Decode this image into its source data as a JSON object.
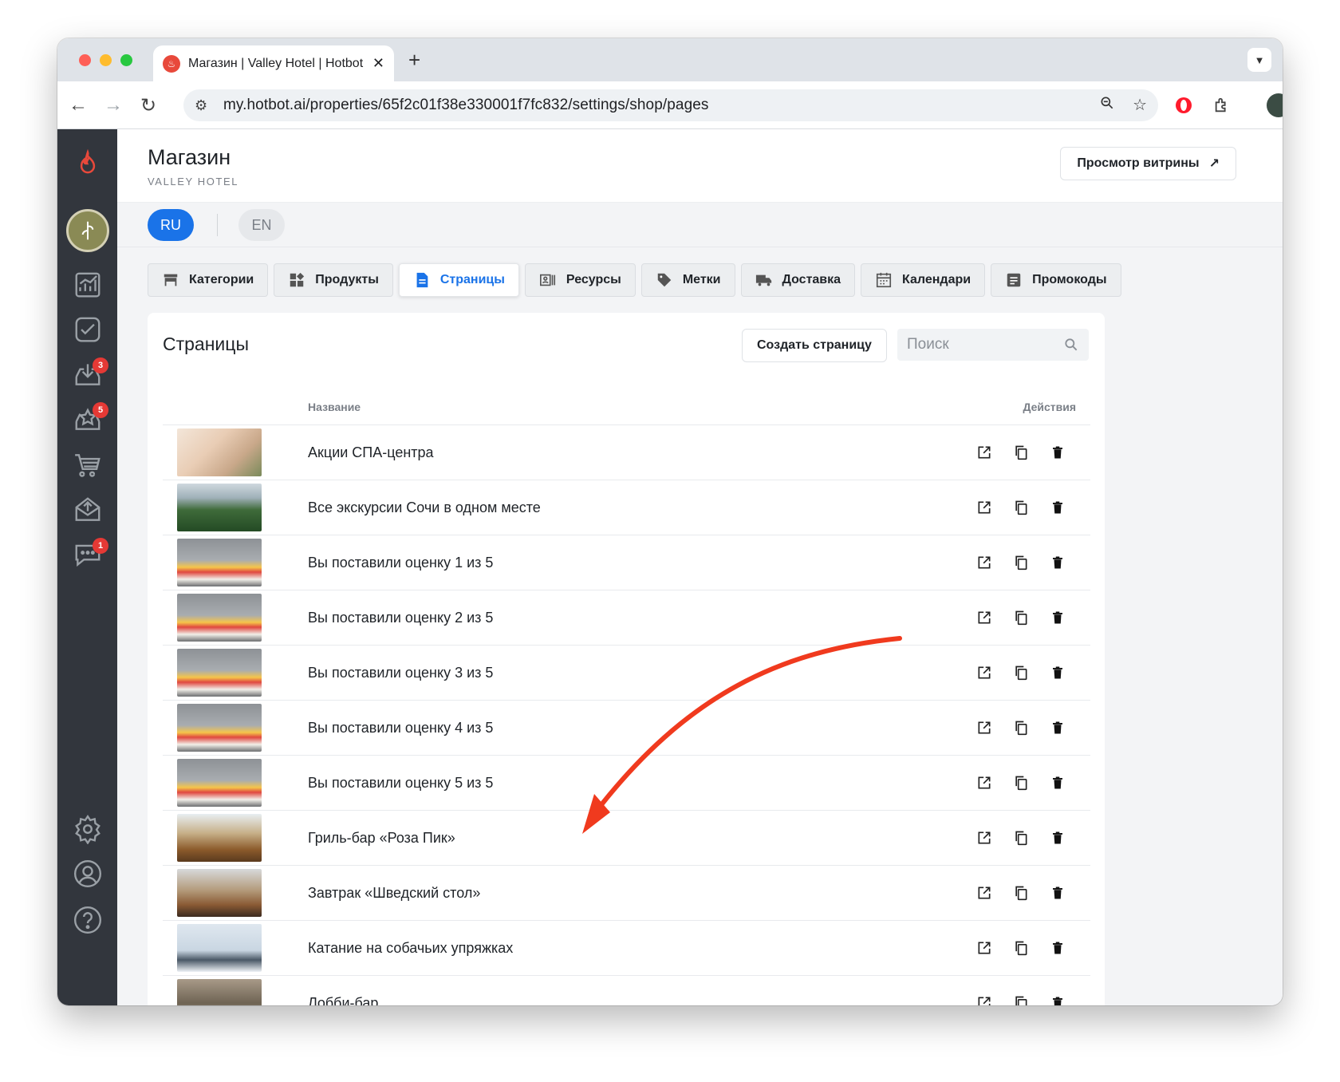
{
  "browser": {
    "tab_title": "Магазин | Valley Hotel | Hotbot",
    "url": "my.hotbot.ai/properties/65f2c01f38e330001f7fc832/settings/shop/pages"
  },
  "header": {
    "title": "Магазин",
    "subtitle": "VALLEY HOTEL",
    "storefront_button": "Просмотр витрины"
  },
  "languages": {
    "ru": "RU",
    "en": "EN"
  },
  "sidebar_badges": {
    "inbox": "3",
    "reviews": "5",
    "chat": "1"
  },
  "tabs": [
    {
      "label": "Категории",
      "icon": "storefront-icon"
    },
    {
      "label": "Продукты",
      "icon": "widgets-icon"
    },
    {
      "label": "Страницы",
      "icon": "document-icon"
    },
    {
      "label": "Ресурсы",
      "icon": "resources-icon"
    },
    {
      "label": "Метки",
      "icon": "tag-icon"
    },
    {
      "label": "Доставка",
      "icon": "truck-icon"
    },
    {
      "label": "Календари",
      "icon": "calendar-icon"
    },
    {
      "label": "Промокоды",
      "icon": "promo-icon"
    }
  ],
  "active_tab": "Страницы",
  "pages_card": {
    "title": "Страницы",
    "create_button": "Создать страницу",
    "search_placeholder": "Поиск",
    "col_name": "Название",
    "col_actions": "Действия",
    "rows": [
      {
        "name": "Акции СПА-центра",
        "thumb": "spa"
      },
      {
        "name": "Все экскурсии Сочи в одном месте",
        "thumb": "mountains"
      },
      {
        "name": "Вы поставили оценку 1 из 5",
        "thumb": "cocktails"
      },
      {
        "name": "Вы поставили оценку 2 из 5",
        "thumb": "cocktails"
      },
      {
        "name": "Вы поставили оценку 3 из 5",
        "thumb": "cocktails"
      },
      {
        "name": "Вы поставили оценку 4 из 5",
        "thumb": "cocktails"
      },
      {
        "name": "Вы поставили оценку 5 из 5",
        "thumb": "cocktails"
      },
      {
        "name": "Гриль-бар «Роза Пик»",
        "thumb": "restaurant"
      },
      {
        "name": "Завтрак «Шведский стол»",
        "thumb": "buffet"
      },
      {
        "name": "Катание на собачьих упряжках",
        "thumb": "snow"
      },
      {
        "name": "Лобби-бар",
        "thumb": "lobby"
      }
    ]
  },
  "colors": {
    "accent": "#1a73e8",
    "sidebar": "#32363d",
    "annotation_arrow": "#f03a1e"
  }
}
